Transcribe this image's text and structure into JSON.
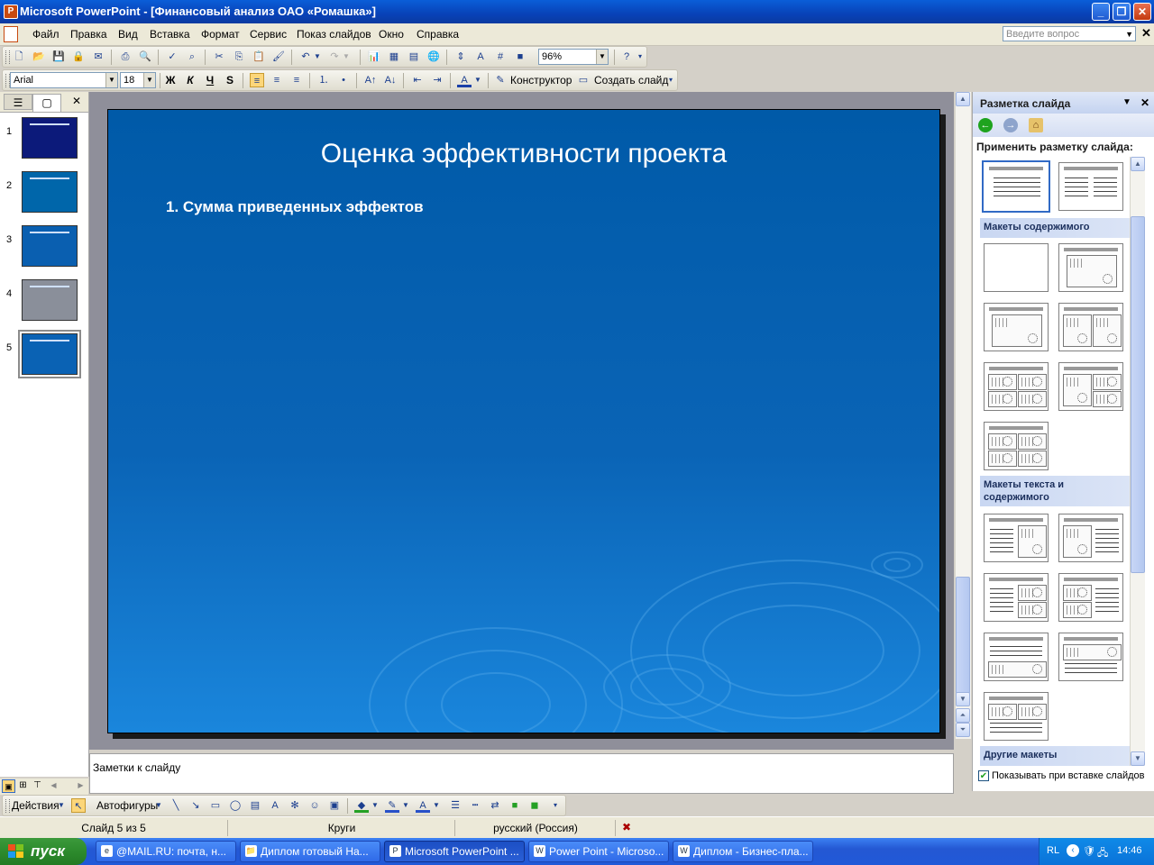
{
  "window": {
    "title": "Microsoft PowerPoint - [Финансовый анализ ОАО «Ромашка»]",
    "app_icon": "P",
    "min": "_",
    "restore": "❐",
    "close": "✕"
  },
  "menu": {
    "items": [
      "Файл",
      "Правка",
      "Вид",
      "Вставка",
      "Формат",
      "Сервис",
      "Показ слайдов",
      "Окно",
      "Справка"
    ],
    "help_placeholder": "Введите вопрос",
    "doc_close": "✕"
  },
  "toolbar_standard": {
    "zoom": "96%"
  },
  "toolbar_formatting": {
    "font": "Arial",
    "size": "18",
    "bold": "Ж",
    "italic": "К",
    "underline": "Ч",
    "shadow": "S",
    "designer": "Конструктор",
    "new_slide": "Создать слайд"
  },
  "left_pane": {
    "tab_outline": "☰",
    "tab_slides": "▢",
    "close": "✕",
    "thumbnails": [
      {
        "num": "1",
        "color": "#0c1a7a"
      },
      {
        "num": "2",
        "color": "#0066aa"
      },
      {
        "num": "3",
        "color": "#0a5fb0"
      },
      {
        "num": "4",
        "color": "#8a8f9a"
      },
      {
        "num": "5",
        "color": "#0a62b4"
      }
    ]
  },
  "slide": {
    "title": "Оценка эффективности проекта",
    "body": "1. Сумма приведенных эффектов"
  },
  "notes": {
    "placeholder": "Заметки к слайду"
  },
  "task_pane": {
    "title": "Разметка слайда",
    "apply_label": "Применить разметку слайда:",
    "sections": {
      "content": "Макеты содержимого",
      "text_content": "Макеты текста и содержимого",
      "other": "Другие макеты"
    },
    "show_on_insert": "Показывать при вставке слайдов",
    "show_on_insert_checked": true
  },
  "drawing_toolbar": {
    "actions": "Действия",
    "autoshapes": "Автофигуры"
  },
  "status": {
    "slide": "Слайд 5 из 5",
    "design": "Круги",
    "language": "русский (Россия)"
  },
  "taskbar": {
    "start": "пуск",
    "tasks": [
      {
        "label": "@MAIL.RU: почта, н...",
        "icon": "e",
        "active": false
      },
      {
        "label": "Диплом готовый На...",
        "icon": "📁",
        "active": false
      },
      {
        "label": "Microsoft PowerPoint ...",
        "icon": "P",
        "active": true
      },
      {
        "label": "Power Point - Microso...",
        "icon": "W",
        "active": false
      },
      {
        "label": "Диплом - Бизнес-пла...",
        "icon": "W",
        "active": false
      }
    ],
    "lang": "RL",
    "time": "14:46"
  }
}
